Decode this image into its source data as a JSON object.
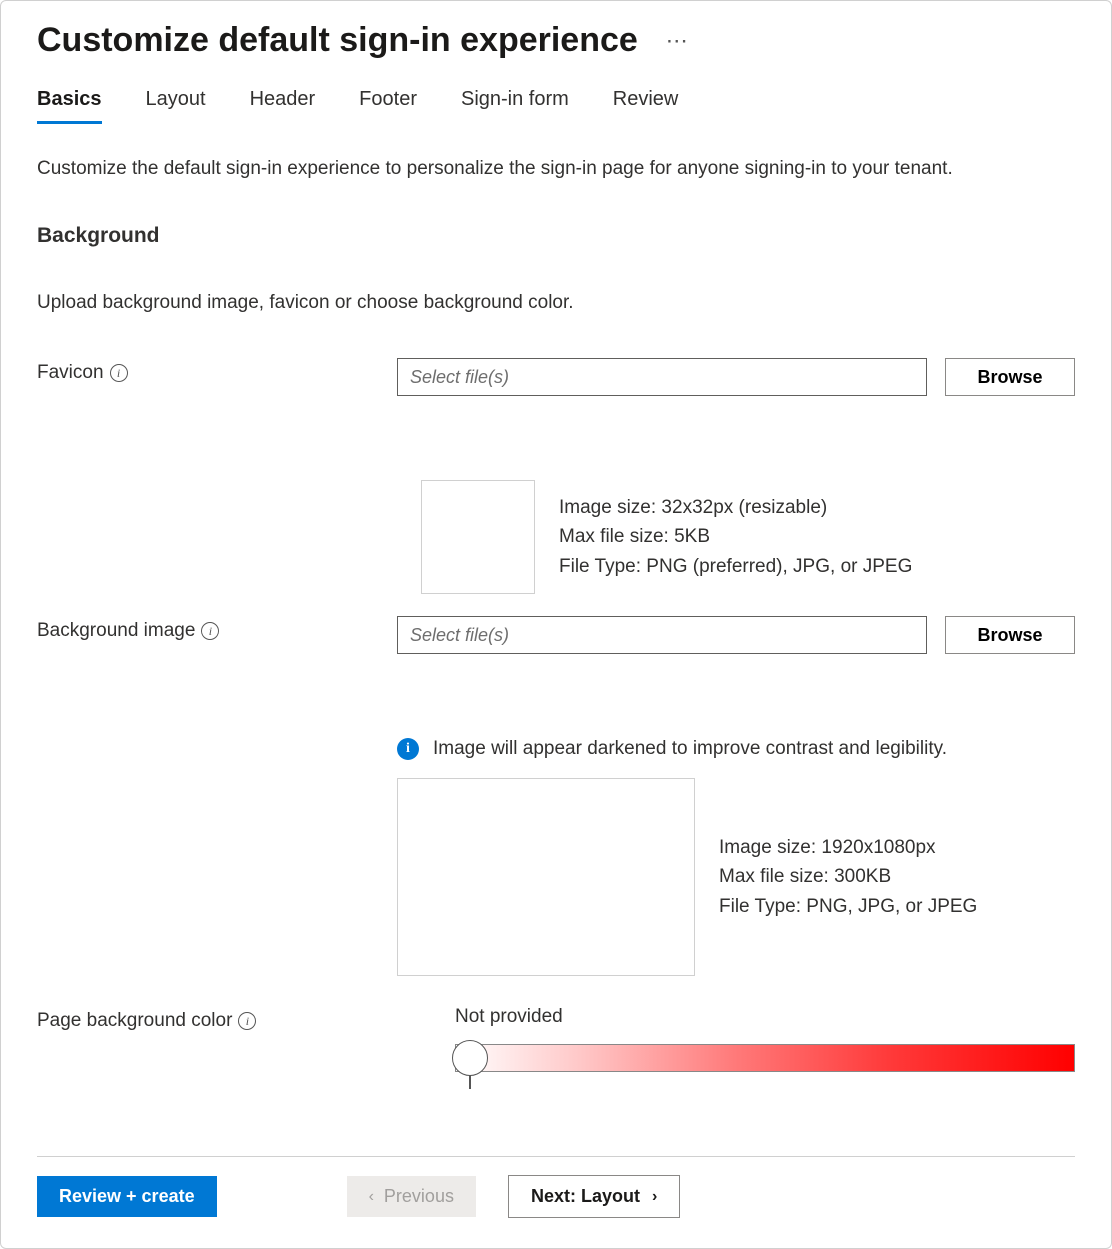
{
  "header": {
    "title": "Customize default sign-in experience"
  },
  "tabs": [
    {
      "label": "Basics",
      "active": true
    },
    {
      "label": "Layout",
      "active": false
    },
    {
      "label": "Header",
      "active": false
    },
    {
      "label": "Footer",
      "active": false
    },
    {
      "label": "Sign-in form",
      "active": false
    },
    {
      "label": "Review",
      "active": false
    }
  ],
  "intro": "Customize the default sign-in experience to personalize the sign-in page for anyone signing-in to your tenant.",
  "section": {
    "heading": "Background",
    "subtext": "Upload background image, favicon or choose background color."
  },
  "favicon": {
    "label": "Favicon",
    "placeholder": "Select file(s)",
    "browse": "Browse",
    "spec_line1": "Image size: 32x32px (resizable)",
    "spec_line2": "Max file size: 5KB",
    "spec_line3": "File Type: PNG (preferred), JPG, or JPEG"
  },
  "background_image": {
    "label": "Background image",
    "placeholder": "Select file(s)",
    "browse": "Browse",
    "banner": "Image will appear darkened to improve contrast and legibility.",
    "spec_line1": "Image size: 1920x1080px",
    "spec_line2": "Max file size: 300KB",
    "spec_line3": "File Type: PNG, JPG, or JPEG"
  },
  "page_bg_color": {
    "label": "Page background color",
    "value": "Not provided"
  },
  "footer": {
    "review_create": "Review + create",
    "previous": "Previous",
    "next": "Next: Layout"
  }
}
